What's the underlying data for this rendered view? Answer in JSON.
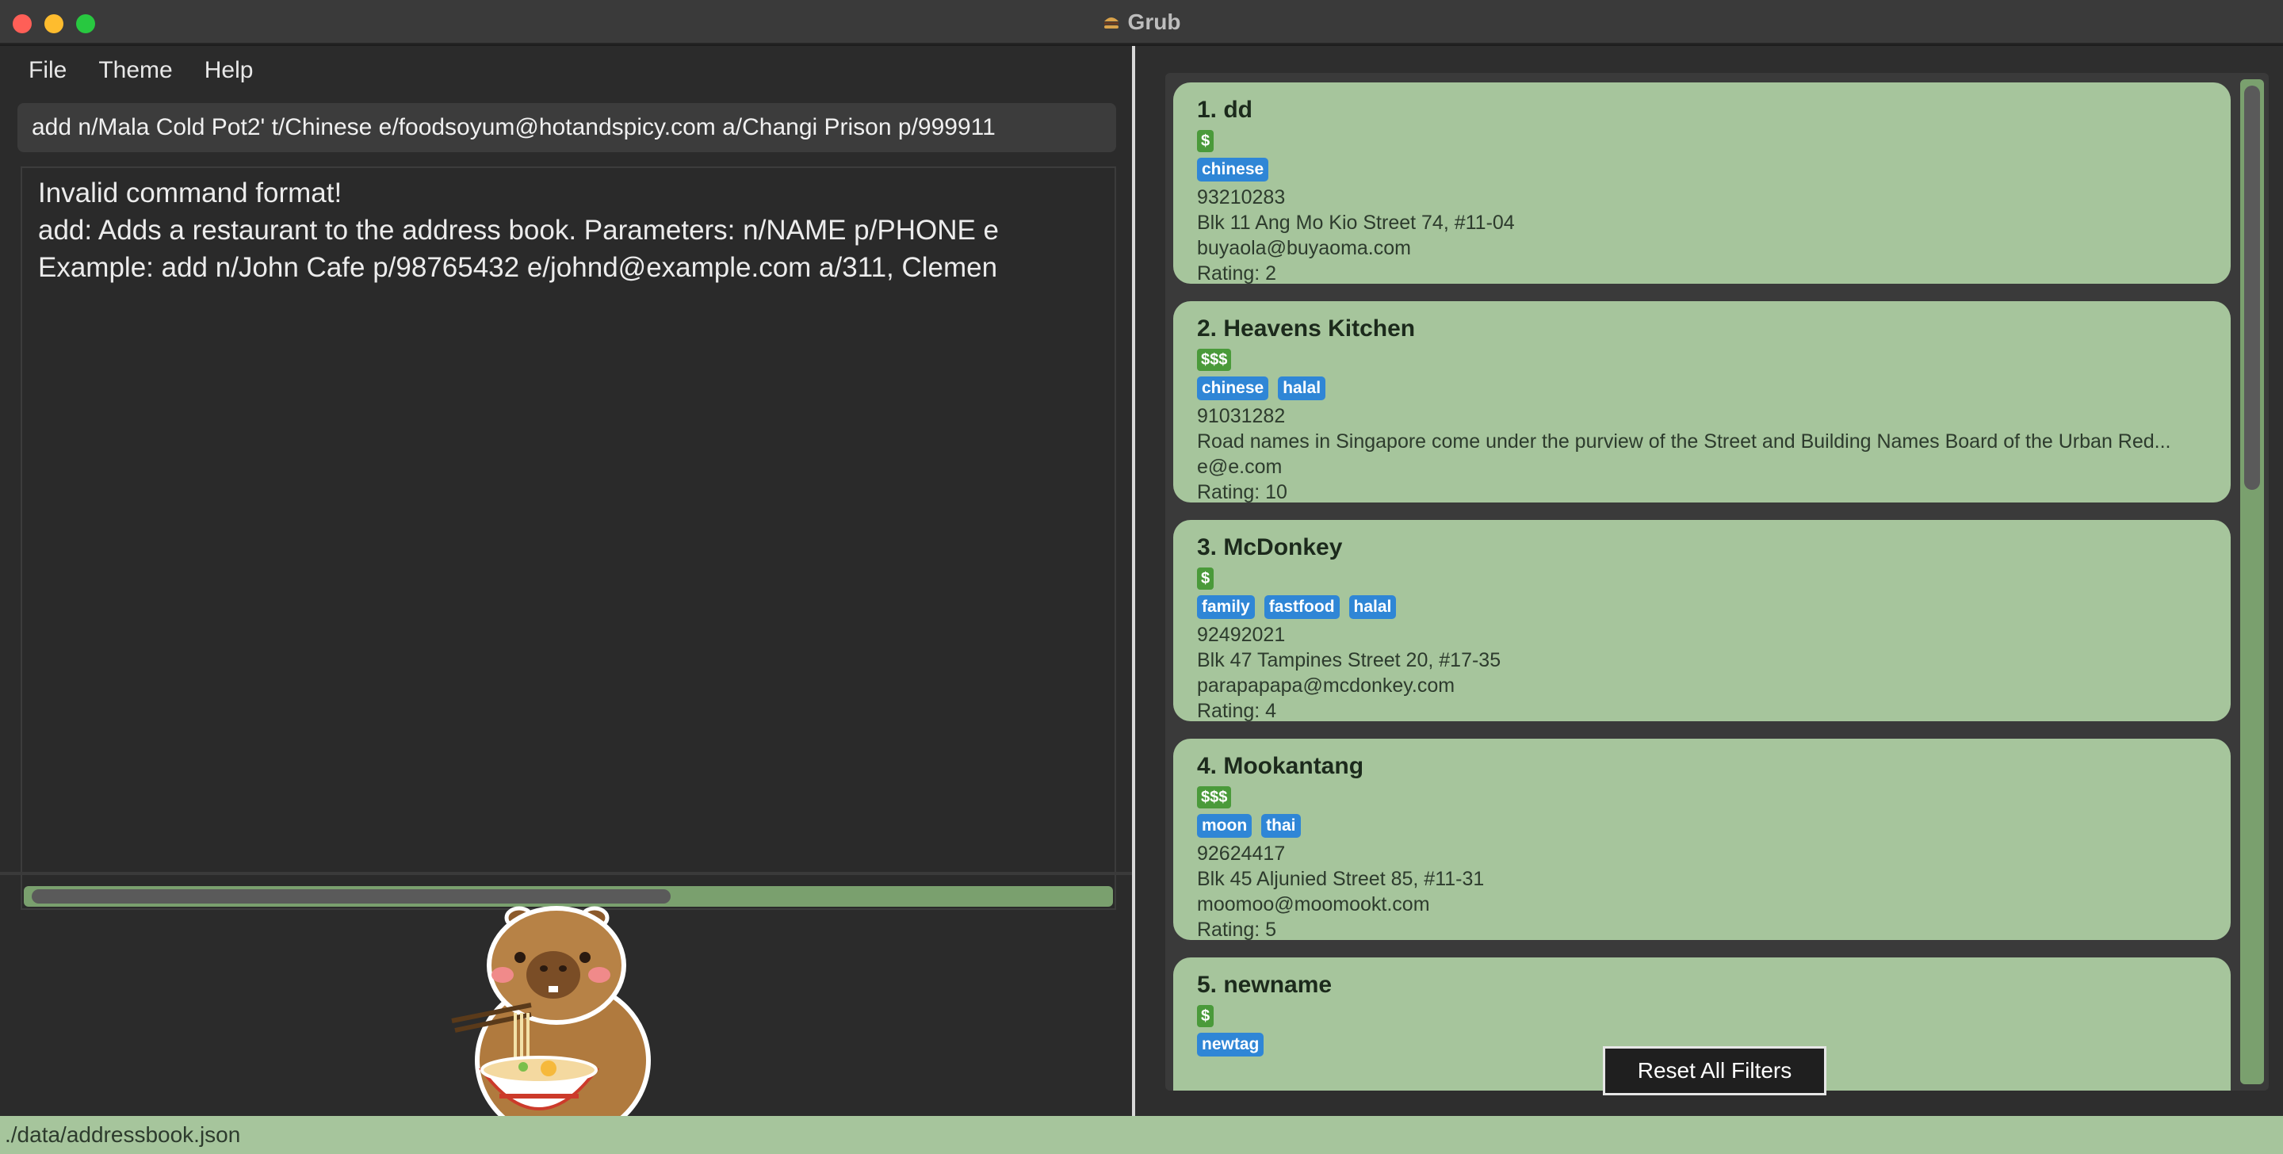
{
  "window": {
    "title": "Grub",
    "controls": [
      "close",
      "minimize",
      "maximize"
    ]
  },
  "menu": {
    "items": [
      {
        "label": "File"
      },
      {
        "label": "Theme"
      },
      {
        "label": "Help"
      }
    ]
  },
  "command": {
    "value": "add n/Mala Cold Pot2' t/Chinese e/foodsoyum@hotandspicy.com a/Changi Prison p/999911"
  },
  "result": {
    "lines": [
      "Invalid command format!",
      "add: Adds a restaurant to the address book. Parameters: n/NAME p/PHONE e",
      "Example: add n/John Cafe p/98765432 e/johnd@example.com a/311, Clemen"
    ]
  },
  "restaurants": [
    {
      "title": "1. dd",
      "price": "$",
      "tags": [
        "chinese"
      ],
      "phone": "93210283",
      "address": "Blk 11 Ang Mo Kio Street 74, #11-04",
      "email": "buyaola@buyaoma.com",
      "rating": "Rating: 2"
    },
    {
      "title": "2. Heavens Kitchen",
      "price": "$$$",
      "tags": [
        "chinese",
        "halal"
      ],
      "phone": "91031282",
      "address": "Road names in Singapore come under the purview of the Street and Building Names Board of the Urban Red...",
      "email": "e@e.com",
      "rating": "Rating: 10"
    },
    {
      "title": "3. McDonkey",
      "price": "$",
      "tags": [
        "family",
        "fastfood",
        "halal"
      ],
      "phone": "92492021",
      "address": "Blk 47 Tampines Street 20, #17-35",
      "email": "parapapapa@mcdonkey.com",
      "rating": "Rating: 4"
    },
    {
      "title": "4. Mookantang",
      "price": "$$$",
      "tags": [
        "moon",
        "thai"
      ],
      "phone": "92624417",
      "address": "Blk 45 Aljunied Street 85, #11-31",
      "email": "moomoo@moomookt.com",
      "rating": "Rating: 5"
    },
    {
      "title": "5. newname",
      "price": "$",
      "tags": [
        "newtag"
      ],
      "phone": "",
      "address": "",
      "email": "",
      "rating": ""
    }
  ],
  "reset_button": {
    "label": "Reset All Filters"
  },
  "status": {
    "path": "./data/addressbook.json"
  },
  "colors": {
    "card_bg": "#a6c59c",
    "tag_bg": "#2f86d6",
    "price_bg": "#4a9a3a",
    "panel_bg": "#2b2b2b",
    "accent_green": "#7aa06e"
  },
  "icons": {
    "title": "burger-icon",
    "mascot": "capybara-ramen-mascot"
  }
}
